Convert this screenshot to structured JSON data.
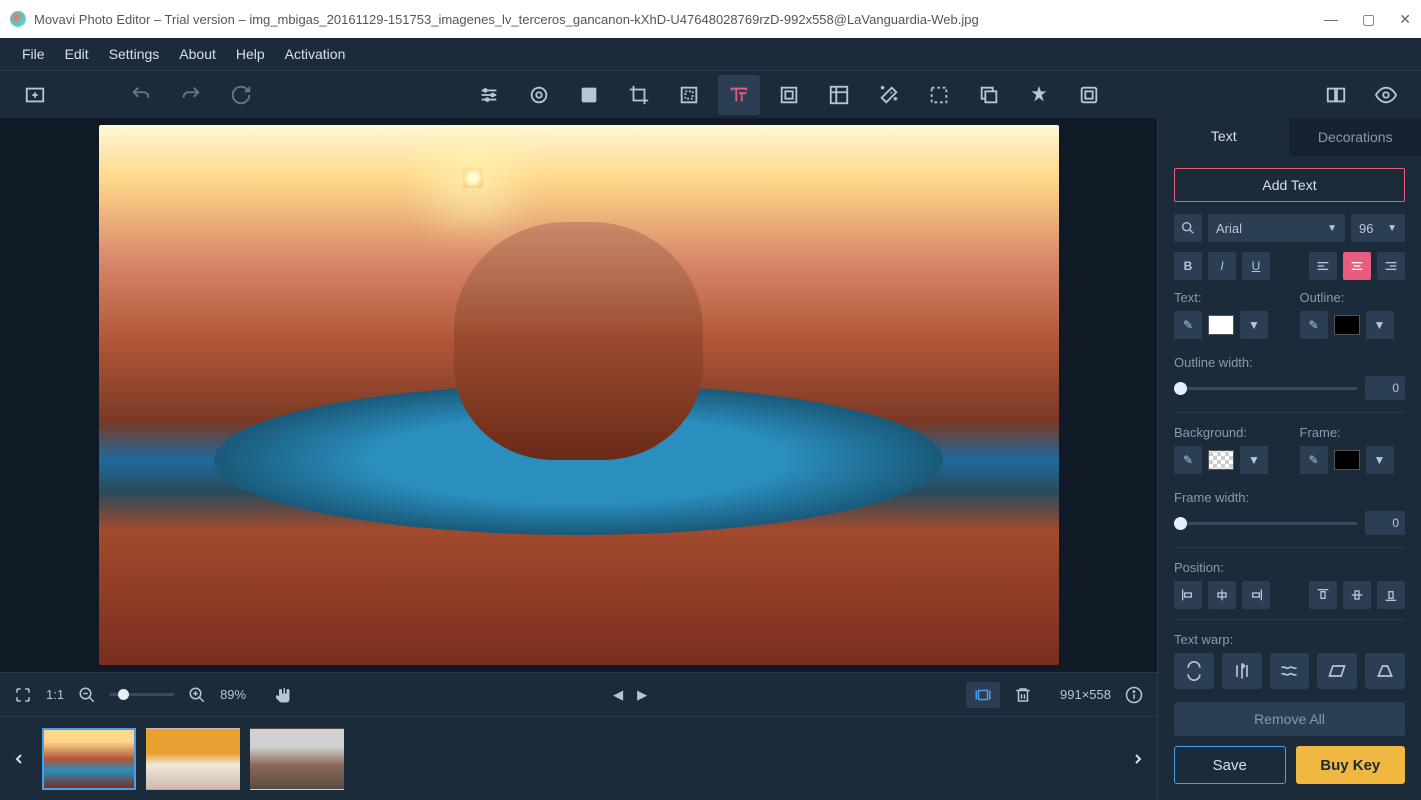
{
  "title": "Movavi Photo Editor – Trial version – img_mbigas_20161129-151753_imagenes_lv_terceros_gancanon-kXhD-U47648028769rzD-992x558@LaVanguardia-Web.jpg",
  "menu": {
    "file": "File",
    "edit": "Edit",
    "settings": "Settings",
    "about": "About",
    "help": "Help",
    "activation": "Activation"
  },
  "status": {
    "fit": "1:1",
    "zoom": "89%",
    "dims": "991×558"
  },
  "side": {
    "tabs": {
      "text": "Text",
      "deco": "Decorations"
    },
    "add": "Add Text",
    "font": "Arial",
    "size": "96",
    "text_lbl": "Text:",
    "outline_lbl": "Outline:",
    "owidth_lbl": "Outline width:",
    "ow_val": "0",
    "bg_lbl": "Background:",
    "frame_lbl": "Frame:",
    "fwidth_lbl": "Frame width:",
    "fw_val": "0",
    "pos_lbl": "Position:",
    "warp_lbl": "Text warp:",
    "remove": "Remove All",
    "save": "Save",
    "buy": "Buy Key"
  },
  "colors": {
    "text": "#ffffff",
    "outline": "#000000",
    "bg": "transparent",
    "frame": "#000000"
  }
}
